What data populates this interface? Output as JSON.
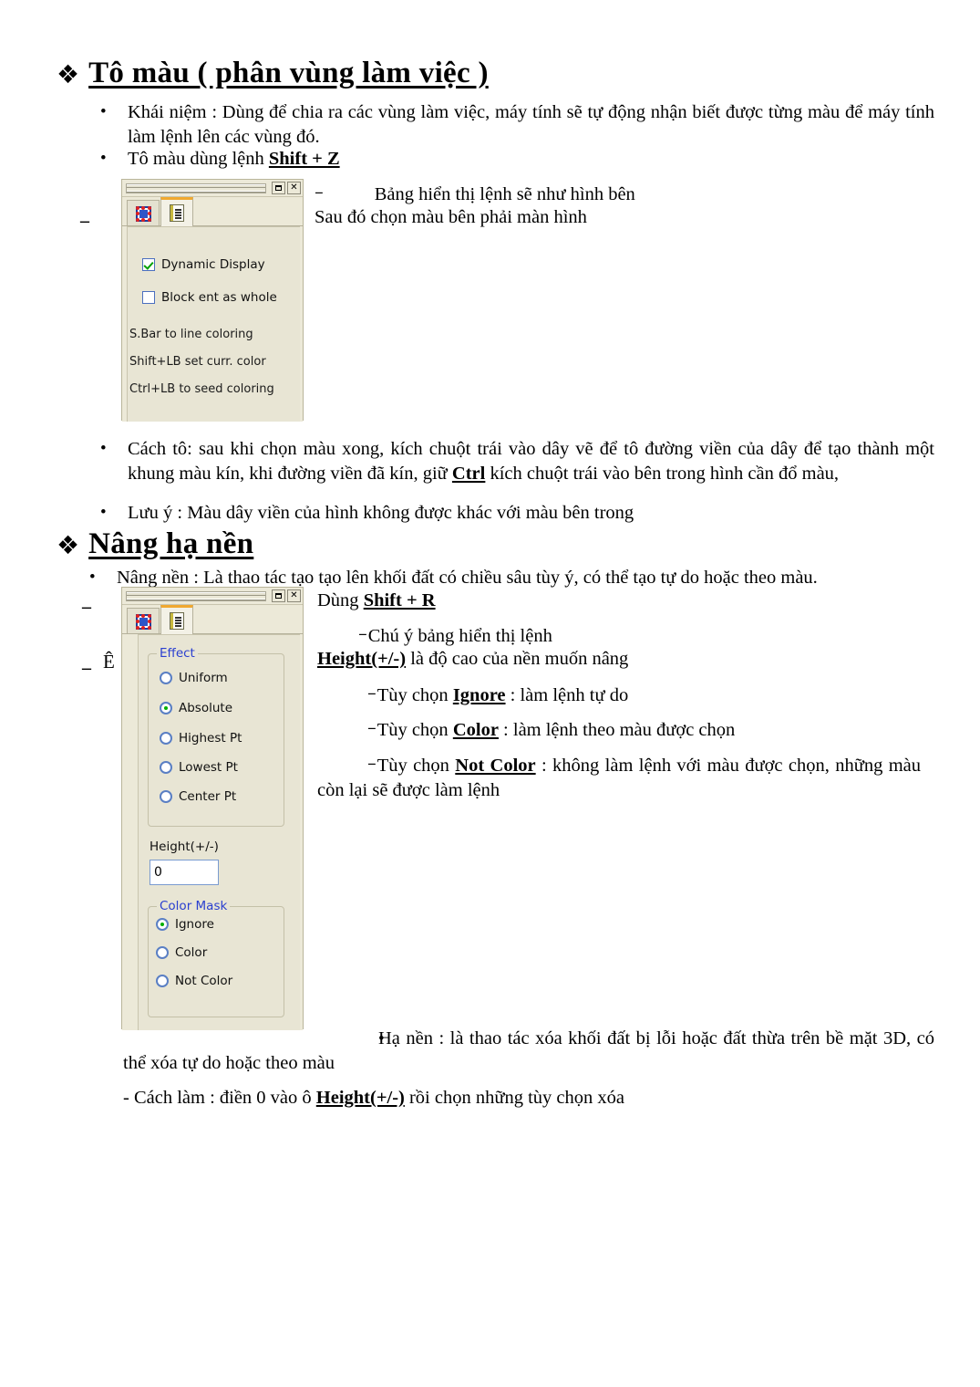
{
  "section1": {
    "heading": "Tô màu ( phân vùng làm việc )",
    "bullet1": "Khái niệm : Dùng để chia ra các vùng làm việc, máy tính sẽ tự động nhận biết được từng màu để máy tính làm lệnh lên các vùng đó.",
    "bullet2_pre": "Tô màu dùng lệnh ",
    "bullet2_kbd": "Shift + Z",
    "note_line1": "Bảng hiển thị lệnh sẽ như hình bên",
    "note_line2": "Sau đó chọn màu bên phải màn hình",
    "bullet3_a": "Cách tô: sau khi chọn màu xong, kích chuột trái vào dây vẽ để tô đường viền của dây để tạo thành một khung màu kín, khi đường viền đã kín, giữ ",
    "bullet3_kbd": "Ctrl",
    "bullet3_b": " kích chuột trái vào bên trong hình cần đổ màu,",
    "bullet4": "Lưu ý : Màu dây viền của hình không được khác với màu bên trong",
    "margin_dash": "–"
  },
  "section2": {
    "heading": "Nâng hạ nền",
    "bullet1": "Nâng nền : Là thao tác tạo tạo lên khối đất có chiều sâu tùy ý, có thể tạo tự do hoặc theo màu.",
    "use_pre": "Dùng ",
    "use_kbd": "Shift + R",
    "note_attention": "Chú ý bảng hiển thị lệnh",
    "height_label": "Height(+/-)",
    "height_desc": " là độ cao của nền muốn nâng",
    "opt_ignore_pre": "Tùy chọn ",
    "opt_ignore_kbd": "Ignore",
    "opt_ignore_post": " : làm lệnh tự do",
    "opt_color_pre": "Tùy chọn ",
    "opt_color_kbd": "Color",
    "opt_color_post": " : làm lệnh theo màu được chọn",
    "opt_notcolor_pre": "Tùy chọn ",
    "opt_notcolor_kbd": "Not Color",
    "opt_notcolor_post": " : không làm lệnh với màu được chọn, những màu còn lại sẽ được làm lệnh",
    "margin_dash": "–",
    "margin_char": "Ê",
    "bottom_bullet": "Hạ nền : là thao tác xóa khối đất bị lỗi hoặc đất thừa trên bề mặt 3D, có thể xóa tự do hoặc theo màu",
    "bottom_howto_pre": "- Cách làm : điền 0 vào ô ",
    "bottom_howto_kbd": "Height(+/-)",
    "bottom_howto_post": " rồi chọn những tùy chọn xóa"
  },
  "dialog1": {
    "name": "coloring-dialog",
    "tab1_icon": "block-grid-icon",
    "tab2_icon": "document-icon",
    "checkbox_dynamic_display": "Dynamic Display",
    "checkbox_dynamic_display_checked": true,
    "checkbox_block_ent": "Block ent as whole",
    "checkbox_block_ent_checked": false,
    "hint1": "S.Bar to line coloring",
    "hint2": "Shift+LB set curr. color",
    "hint3": "Ctrl+LB to seed coloring",
    "maximize_label": "□",
    "close_label": "✕"
  },
  "dialog2": {
    "name": "elevation-dialog",
    "tab1_icon": "block-grid-icon",
    "tab2_icon": "document-icon",
    "effect_group": "Effect",
    "effect_options": [
      {
        "label": "Uniform",
        "selected": false
      },
      {
        "label": "Absolute",
        "selected": true
      },
      {
        "label": "Highest Pt",
        "selected": false
      },
      {
        "label": "Lowest Pt",
        "selected": false
      },
      {
        "label": "Center Pt",
        "selected": false
      }
    ],
    "height_label": "Height(+/-)",
    "height_value": "0",
    "colormask_group": "Color Mask",
    "colormask_options": [
      {
        "label": "Ignore",
        "selected": true
      },
      {
        "label": "Color",
        "selected": false
      },
      {
        "label": "Not Color",
        "selected": false
      }
    ],
    "maximize_label": "□",
    "close_label": "✕"
  },
  "colors": {
    "dialog_bg": "#ece9d8",
    "panel_bg": "#e8e5d4",
    "group_title": "#2a3fd0",
    "radio_border": "#5a7fc4",
    "radio_dot": "#00b000",
    "check_mark": "#00a000",
    "tab_active_top": "#f0a830"
  }
}
